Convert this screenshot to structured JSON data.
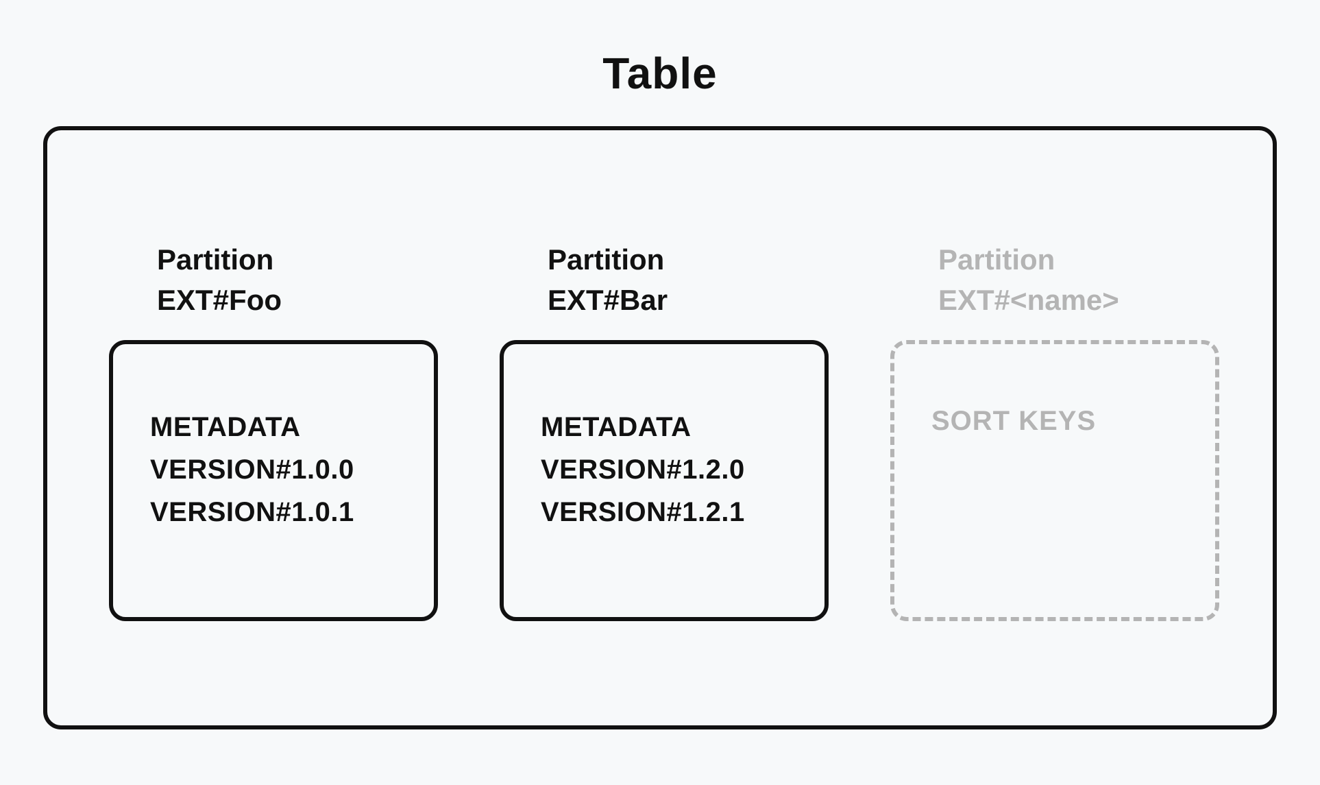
{
  "title": "Table",
  "partitions": [
    {
      "label_line1": "Partition",
      "label_line2": "EXT#Foo",
      "items": [
        "METADATA",
        "VERSION#1.0.0",
        "VERSION#1.0.1"
      ],
      "style": "solid"
    },
    {
      "label_line1": "Partition",
      "label_line2": "EXT#Bar",
      "items": [
        "METADATA",
        "VERSION#1.2.0",
        "VERSION#1.2.1"
      ],
      "style": "solid"
    },
    {
      "label_line1": "Partition",
      "label_line2": "EXT#<name>",
      "placeholder": "SORT KEYS",
      "style": "dashed"
    }
  ]
}
